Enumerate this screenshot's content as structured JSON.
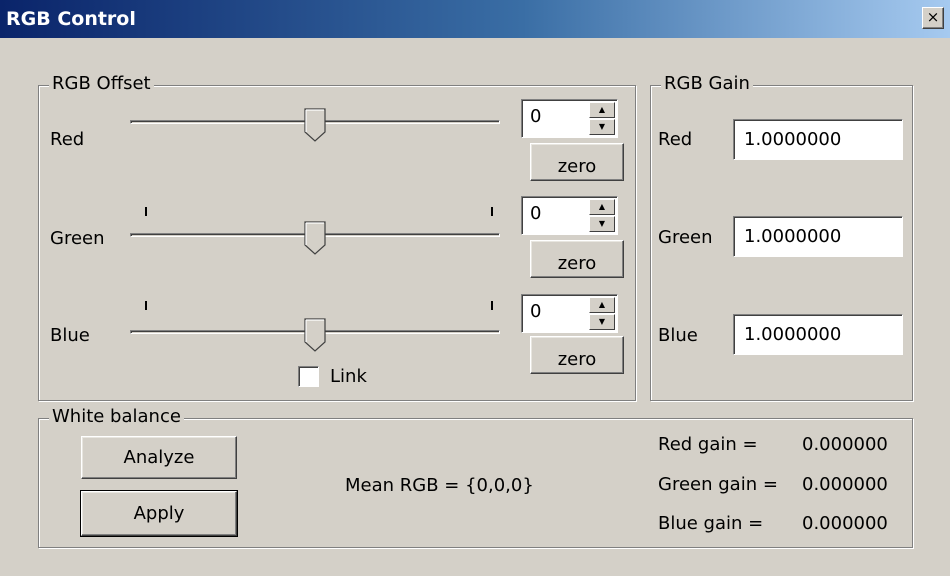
{
  "window": {
    "title": "RGB Control",
    "close_label": "×"
  },
  "offset": {
    "legend": "RGB Offset",
    "channels": [
      {
        "label": "Red",
        "value": "0",
        "level": 0.5,
        "zero_label": "zero"
      },
      {
        "label": "Green",
        "value": "0",
        "level": 0.5,
        "zero_label": "zero"
      },
      {
        "label": "Blue",
        "value": "0",
        "level": 0.5,
        "zero_label": "zero"
      }
    ],
    "link_label": "Link",
    "link_checked": false
  },
  "gain": {
    "legend": "RGB Gain",
    "channels": [
      {
        "label": "Red",
        "value": "1.0000000"
      },
      {
        "label": "Green",
        "value": "1.0000000"
      },
      {
        "label": "Blue",
        "value": "1.0000000"
      }
    ]
  },
  "white_balance": {
    "legend": "White balance",
    "analyze_label": "Analyze",
    "apply_label": "Apply",
    "mean_text": "Mean RGB = {0,0,0}",
    "results": [
      {
        "label": "Red gain =",
        "value": "0.000000"
      },
      {
        "label": "Green gain =",
        "value": "0.000000"
      },
      {
        "label": "Blue gain =",
        "value": "0.000000"
      }
    ]
  },
  "colors": {
    "face": "#d4d0c8",
    "title_start": "#0a246a",
    "title_end": "#a6caf0"
  }
}
